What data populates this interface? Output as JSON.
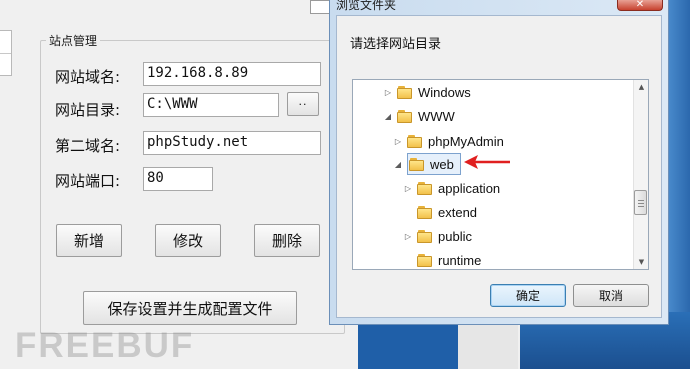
{
  "site_manager": {
    "group_title": "站点管理",
    "domain_label": "网站域名:",
    "domain_value": "192.168.8.89",
    "dir_label": "网站目录:",
    "dir_value": "C:\\WWW",
    "browse_label": "··",
    "second_domain_label": "第二域名:",
    "second_domain_value": "phpStudy.net",
    "port_label": "网站端口:",
    "port_value": "80",
    "add_label": "新增",
    "modify_label": "修改",
    "delete_label": "删除",
    "save_label": "保存设置并生成配置文件"
  },
  "dialog": {
    "title": "浏览文件夹",
    "close_glyph": "✕",
    "prompt": "请选择网站目录",
    "tree": [
      {
        "label": "Windows",
        "expander": "collapsed"
      },
      {
        "label": "WWW",
        "expander": "expanded"
      },
      {
        "label": "phpMyAdmin",
        "expander": "collapsed"
      },
      {
        "label": "web",
        "expander": "expanded",
        "selected": true
      },
      {
        "label": "application",
        "expander": "collapsed"
      },
      {
        "label": "extend",
        "expander": "none"
      },
      {
        "label": "public",
        "expander": "collapsed"
      },
      {
        "label": "runtime",
        "expander": "none"
      }
    ],
    "ok_label": "确定",
    "cancel_label": "取消"
  },
  "glyphs": {
    "collapsed": "▷",
    "expanded": "◢",
    "scroll_up": "▲",
    "scroll_down": "▼"
  },
  "watermark": "FREEBUF",
  "colors": {
    "annotation_arrow": "#e02020",
    "window_blue": "#1f5fa8"
  }
}
